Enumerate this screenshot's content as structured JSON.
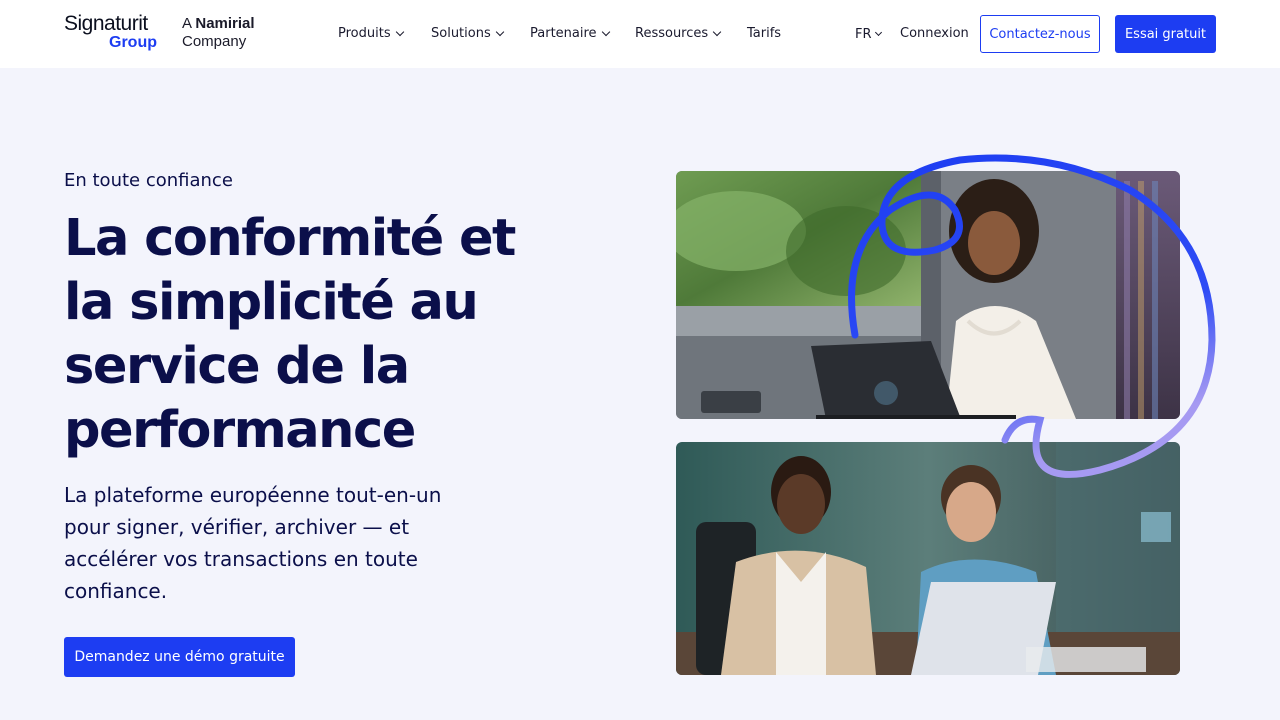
{
  "header": {
    "logo": {
      "main": "Signaturit",
      "sub": "Group"
    },
    "tagline": {
      "prefix": "A",
      "brand": "Namirial",
      "suffix": "Company"
    },
    "nav": [
      {
        "label": "Produits",
        "has_dropdown": true
      },
      {
        "label": "Solutions",
        "has_dropdown": true
      },
      {
        "label": "Partenaire",
        "has_dropdown": true
      },
      {
        "label": "Ressources",
        "has_dropdown": true
      },
      {
        "label": "Tarifs",
        "has_dropdown": false
      }
    ],
    "language": "FR",
    "login": "Connexion",
    "contact_button": "Contactez-nous",
    "trial_button": "Essai gratuit"
  },
  "hero": {
    "eyebrow": "En toute confiance",
    "headline": "La conformité et la simplicité au service de la performance",
    "subtext": "La plateforme européenne tout-en-un pour signer, vérifier, archiver — et accélérer vos transactions en toute confiance.",
    "cta": "Demandez une démo gratuite"
  },
  "colors": {
    "accent": "#1d3df2",
    "navy": "#0b0f4a",
    "background": "#f3f4fc",
    "header_bg": "#ffffff"
  },
  "images": {
    "top_photo": "woman-on-train-with-laptop",
    "bottom_photo": "two-men-looking-at-laptop",
    "decoration": "blue-swirl-line"
  }
}
